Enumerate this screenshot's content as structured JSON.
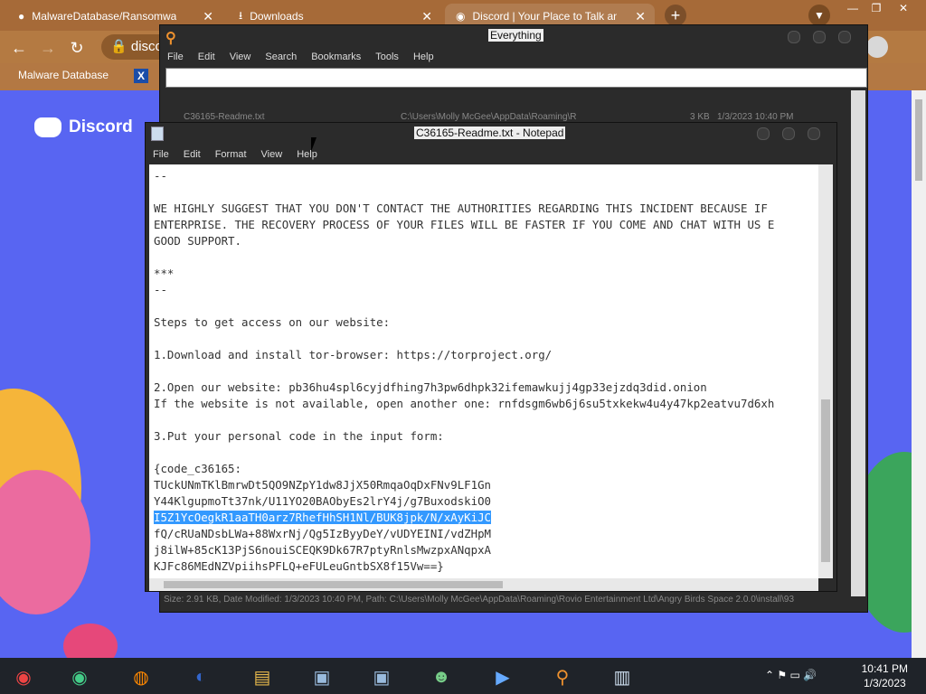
{
  "browser": {
    "tabs": [
      {
        "label": "MalwareDatabase/Ransomware a",
        "icon": "github-icon"
      },
      {
        "label": "Downloads",
        "icon": "download-icon"
      },
      {
        "label": "Discord | Your Place to Talk and",
        "icon": "globe-icon"
      }
    ],
    "address_partial": "disco",
    "bookmarks": [
      {
        "label": "Malware Database"
      }
    ],
    "bookmark2_badge": "X",
    "new_tab": "+",
    "window_controls": [
      "—",
      "❐",
      "✕"
    ]
  },
  "discord": {
    "logo_text": "Discord"
  },
  "everything": {
    "title": "Everything",
    "menu": [
      "File",
      "Edit",
      "View",
      "Search",
      "Bookmarks",
      "Tools",
      "Help"
    ],
    "search_value": "",
    "row": {
      "name": "C36165-Readme.txt",
      "path": "C:\\Users\\Molly McGee\\AppData\\Roaming\\R",
      "size": "3 KB",
      "date": "1/3/2023 10:40 PM"
    },
    "status": "Size: 2.91 KB, Date Modified: 1/3/2023 10:40 PM, Path: C:\\Users\\Molly McGee\\AppData\\Roaming\\Rovio Entertainment Ltd\\Angry Birds Space 2.0.0\\install\\93"
  },
  "notepad": {
    "title": "C36165-Readme.txt - Notepad",
    "menu": [
      "File",
      "Edit",
      "Format",
      "View",
      "Help"
    ],
    "lines": [
      "--",
      "",
      "WE HIGHLY SUGGEST THAT YOU DON'T CONTACT THE AUTHORITIES REGARDING THIS INCIDENT BECAUSE IF",
      "ENTERPRISE. THE RECOVERY PROCESS OF YOUR FILES WILL BE FASTER IF YOU COME AND CHAT WITH US E",
      "GOOD SUPPORT.",
      "",
      "***",
      "--",
      "",
      "Steps to get access on our website:",
      "",
      "1.Download and install tor-browser: https://torproject.org/",
      "",
      "2.Open our website: pb36hu4spl6cyjdfhing7h3pw6dhpk32ifemawkujj4gp33ejzdq3did.onion",
      "If the website is not available, open another one: rnfdsgm6wb6j6su5txkekw4u4y47kp2eatvu7d6xh",
      "",
      "3.Put your personal code in the input form:",
      "",
      "{code_c36165:",
      "TUckUNmTKlBmrwDt5QO9NZpY1dw8JjX50RmqaOqDxFNv9LF1Gn",
      "Y44KlgupmoTt37nk/U11YO20BAObyEs2lrY4j/g7BuxodskiO0",
      "I5Z1YcOegkR1aaTH0arz7RhefHhSH1Nl/BUK8jpk/N/xAyKiJC",
      "fQ/cRUaNDsbLWa+88WxrNj/Qg5IzByyDeY/vUDYEINI/vdZHpM",
      "j8ilW+85cK13PjS6nouiSCEQK9Dk67R7ptyRnlsMwzpxANqpxA",
      "KJFc86MEdNZVpiihsPFLQ+eFULeuGntbSX8f15Vw==}"
    ],
    "selected_line_index": 21
  },
  "taskbar": {
    "apps": [
      "chrome-old-icon",
      "chrome-icon",
      "firefox-icon",
      "obama-icon",
      "explorer-icon",
      "installer-icon",
      "installer2-icon",
      "users-icon",
      "powershell-icon",
      "everything-icon",
      "notepad-icon"
    ],
    "time": "10:41 PM",
    "date": "1/3/2023"
  }
}
